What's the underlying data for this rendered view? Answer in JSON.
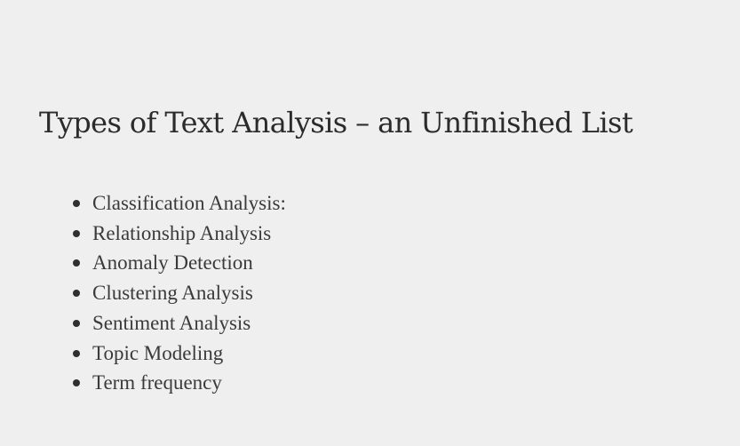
{
  "page": {
    "title": "Types of Text Analysis – an Unfinished List"
  },
  "list": {
    "items": [
      "Classification Analysis:",
      "Relationship Analysis",
      "Anomaly Detection",
      "Clustering Analysis",
      "Sentiment Analysis",
      "Topic Modeling",
      "Term frequency"
    ]
  },
  "colors": {
    "background": "#efefef",
    "heading": "#2b2b2b",
    "text": "#3a3a3a"
  }
}
